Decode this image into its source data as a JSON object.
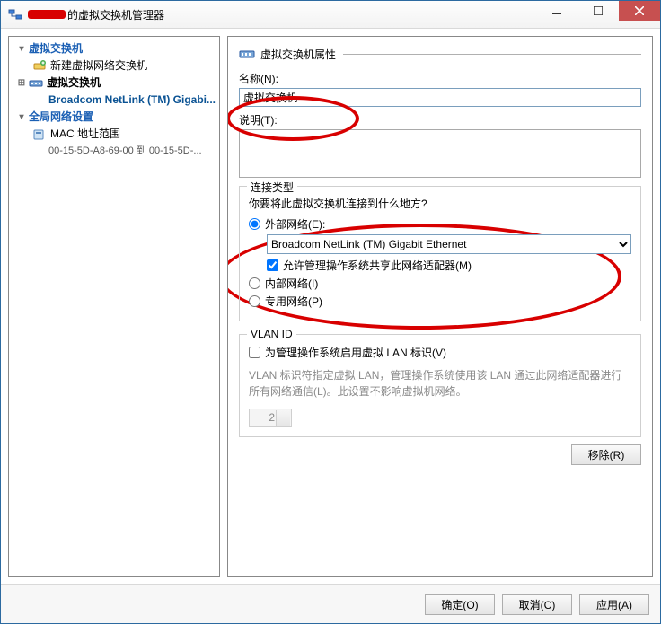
{
  "title_suffix": " 的虚拟交换机管理器",
  "tree": {
    "h1": "虚拟交换机",
    "new_switch": "新建虚拟网络交换机",
    "h2": "虚拟交换机",
    "selected": "Broadcom NetLink (TM) Gigabi...",
    "h3": "全局网络设置",
    "mac_label": "MAC 地址范围",
    "mac_range": "00-15-5D-A8-69-00 到 00-15-5D-..."
  },
  "panel": {
    "header": "虚拟交换机属性",
    "name_label": "名称(N):",
    "name_value": "虚拟交换机",
    "desc_label": "说明(T):",
    "desc_value": "",
    "conn_group": "连接类型",
    "conn_prompt": "你要将此虚拟交换机连接到什么地方?",
    "ext_label": "外部网络(E):",
    "ext_adapter": "Broadcom NetLink (TM) Gigabit Ethernet",
    "allow_mgmt": "允许管理操作系统共享此网络适配器(M)",
    "int_label": "内部网络(I)",
    "priv_label": "专用网络(P)",
    "vlan_group": "VLAN ID",
    "vlan_check": "为管理操作系统启用虚拟 LAN 标识(V)",
    "vlan_help": "VLAN 标识符指定虚拟 LAN，管理操作系统使用该 LAN 通过此网络适配器进行所有网络通信(L)。此设置不影响虚拟机网络。",
    "vlan_value": "2",
    "remove": "移除(R)"
  },
  "footer": {
    "ok": "确定(O)",
    "cancel": "取消(C)",
    "apply": "应用(A)"
  }
}
